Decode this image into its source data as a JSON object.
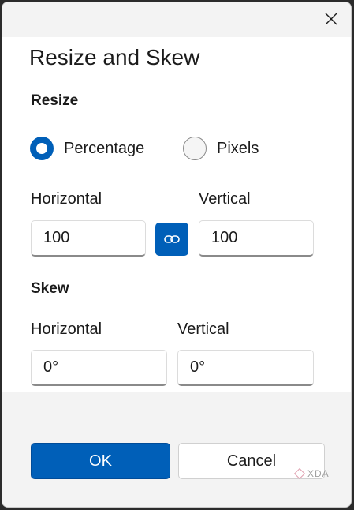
{
  "dialog": {
    "title": "Resize and Skew"
  },
  "resize": {
    "heading": "Resize",
    "mode_options": [
      {
        "label": "Percentage",
        "selected": true
      },
      {
        "label": "Pixels",
        "selected": false
      }
    ],
    "horizontal_label": "Horizontal",
    "horizontal_value": "100",
    "vertical_label": "Vertical",
    "vertical_value": "100",
    "link_icon": "link-icon"
  },
  "skew": {
    "heading": "Skew",
    "horizontal_label": "Horizontal",
    "horizontal_value": "0°",
    "vertical_label": "Vertical",
    "vertical_value": "0°"
  },
  "footer": {
    "ok_label": "OK",
    "cancel_label": "Cancel"
  },
  "watermark": "XDA",
  "colors": {
    "accent": "#005fb8",
    "footer_bg": "#f3f3f3"
  }
}
